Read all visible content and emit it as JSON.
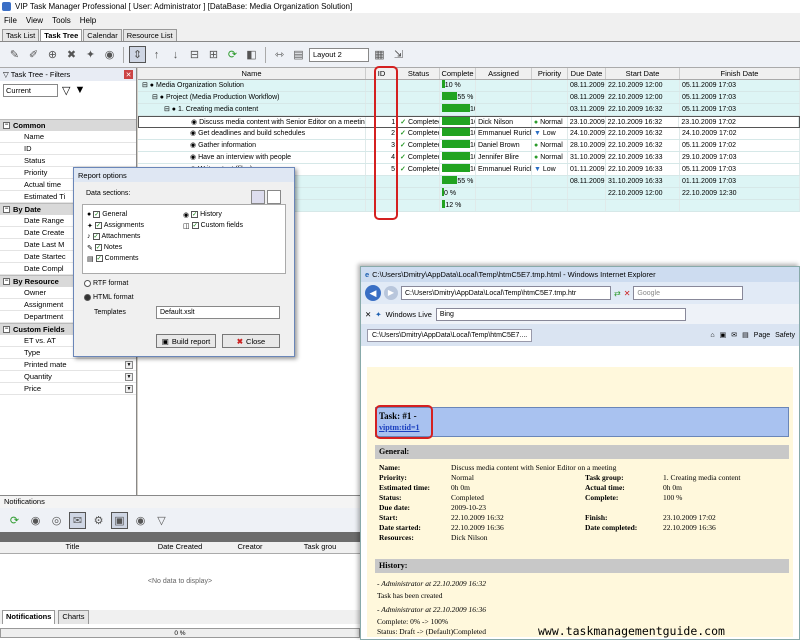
{
  "app": {
    "title": "VIP Task Manager Professional [ User: Administrator ] [DataBase: Media Organization Solution]",
    "menu": [
      "File",
      "View",
      "Tools",
      "Help"
    ],
    "tabs": [
      "Task List",
      "Task Tree",
      "Calendar",
      "Resource List"
    ],
    "active_tab": "Task Tree",
    "layout_select": "Layout 2"
  },
  "left_panel": {
    "title": "Task Tree - Filters",
    "filter_combo": "Current",
    "sections": [
      {
        "name": "Common",
        "items": [
          "Name",
          "ID",
          "Status",
          "Priority",
          "Actual time",
          "Estimated Ti"
        ]
      },
      {
        "name": "By Date",
        "items": [
          "Date Range",
          "Date Create",
          "Date Last M",
          "Date Startec",
          "Date Compl"
        ]
      },
      {
        "name": "By Resource",
        "items": [
          "Owner",
          "Assignment",
          "Department"
        ]
      },
      {
        "name": "Custom Fields",
        "items": [
          "ET vs. AT",
          "Type",
          "Printed mate",
          "Quantity",
          "Price"
        ]
      }
    ]
  },
  "grid": {
    "columns": [
      "Name",
      "ID",
      "Status",
      "Complete",
      "Assigned",
      "Priority",
      "Due Date",
      "Start Date",
      "Finish Date"
    ],
    "rows": [
      {
        "name": "Media Organization Solution",
        "id": "",
        "status": "",
        "complete": "10 %",
        "assigned": "",
        "priority": "",
        "due": "08.11.2009",
        "start": "22.10.2009 12:00",
        "finish": "05.11.2009 17:03"
      },
      {
        "name": "Project (Media Production Workflow)",
        "id": "",
        "status": "",
        "complete": "55 %",
        "assigned": "",
        "priority": "",
        "due": "08.11.2009",
        "start": "22.10.2009 12:00",
        "finish": "05.11.2009 17:03"
      },
      {
        "name": "1. Creating media content",
        "id": "",
        "status": "",
        "complete": "100 %",
        "assigned": "",
        "priority": "",
        "due": "03.11.2009",
        "start": "22.10.2009 16:32",
        "finish": "05.11.2009 17:03"
      },
      {
        "name": "Discuss media content with Senior Editor on a meeting",
        "id": "1",
        "status": "Completed",
        "complete": "100 %",
        "assigned": "Dick Nilson",
        "priority": "Normal",
        "due": "23.10.2009",
        "start": "22.10.2009 16:32",
        "finish": "23.10.2009 17:02"
      },
      {
        "name": "Get deadlines and build schedules",
        "id": "2",
        "status": "Completed",
        "complete": "100 %",
        "assigned": "Emmanuel Rurichi",
        "priority": "Low",
        "due": "24.10.2009",
        "start": "22.10.2009 16:32",
        "finish": "24.10.2009 17:02"
      },
      {
        "name": "Gather information",
        "id": "3",
        "status": "Completed",
        "complete": "100 %",
        "assigned": "Daniel Brown",
        "priority": "Normal",
        "due": "28.10.2009",
        "start": "22.10.2009 16:32",
        "finish": "05.11.2009 17:02"
      },
      {
        "name": "Have an interview with people",
        "id": "4",
        "status": "Completed",
        "complete": "100 %",
        "assigned": "Jennifer Blire",
        "priority": "Normal",
        "due": "31.10.2009",
        "start": "22.10.2009 16:33",
        "finish": "29.10.2009 17:03"
      },
      {
        "name": "Write a text (files)",
        "id": "5",
        "status": "Completed",
        "complete": "100 %",
        "assigned": "Emmanuel Rurichi",
        "priority": "Low",
        "due": "01.11.2009",
        "start": "22.10.2009 16:33",
        "finish": "05.11.2009 17:03"
      },
      {
        "name": "",
        "id": "",
        "status": "",
        "complete": "55 %",
        "assigned": "",
        "priority": "",
        "due": "08.11.2009",
        "start": "31.10.2009 16:33",
        "finish": "01.11.2009 17:03"
      },
      {
        "name": "",
        "id": "",
        "status": "",
        "complete": "0 %",
        "assigned": "",
        "priority": "",
        "due": "",
        "start": "22.10.2009 12:00",
        "finish": "22.10.2009 12:30"
      },
      {
        "name": "",
        "id": "",
        "status": "",
        "complete": "12 %",
        "assigned": "",
        "priority": "",
        "due": "",
        "start": "",
        "finish": ""
      }
    ]
  },
  "dialog": {
    "title": "Report options",
    "data_sections_label": "Data sections:",
    "left_checks": [
      "General",
      "Assignments",
      "Attachments",
      "Notes",
      "Comments"
    ],
    "right_checks": [
      "History",
      "Custom fields"
    ],
    "rtf": "RTF format",
    "html": "HTML format",
    "templates_label": "Templates",
    "template_value": "Default.xslt",
    "build": "Build report",
    "close": "Close"
  },
  "notifications": {
    "title": "Notifications",
    "columns": [
      "Title",
      "Date Created",
      "Creator",
      "Task grou"
    ],
    "empty": "<No data to display>",
    "tabs": [
      "Notifications",
      "Charts"
    ],
    "progress": "0 %"
  },
  "browser": {
    "title": "C:\\Users\\Dmitry\\AppData\\Local\\Temp\\htmC5E7.tmp.html - Windows Internet Explorer",
    "url": "C:\\Users\\Dmitry\\AppData\\Local\\Temp\\htmC5E7.tmp.htr",
    "search_placeholder": "Google",
    "windows_live": "Windows Live",
    "bing": "Bing",
    "tab_label": "C:\\Users\\Dmitry\\AppData\\Local\\Temp\\htmC5E7....",
    "page_menu": "Page",
    "safety_menu": "Safety",
    "report": {
      "task_heading": "Task: #1 -",
      "task_link": "viptm:tid=1",
      "general": "General:",
      "name_k": "Name:",
      "name_v": "Discuss media content with Senior Editor on a meeting",
      "priority_k": "Priority:",
      "priority_v": "Normal",
      "est_k": "Estimated time:",
      "est_v": "0h 0m",
      "status_k": "Status:",
      "status_v": "Completed",
      "due_k": "Due date:",
      "due_v": "2009-10-23",
      "start_k": "Start:",
      "start_v": "22.10.2009 16:32",
      "started_k": "Date started:",
      "started_v": "22.10.2009 16:36",
      "res_k": "Resources:",
      "res_v": "Dick Nilson",
      "group_k": "Task group:",
      "group_v": "1. Creating media content",
      "actual_k": "Actual time:",
      "actual_v": "0h 0m",
      "complete_k": "Complete:",
      "complete_v": "100 %",
      "finish_k": "Finish:",
      "finish_v": "23.10.2009 17:02",
      "completed_k": "Date completed:",
      "completed_v": "22.10.2009 16:36",
      "history": "History:",
      "h1": "- Administrator at 22.10.2009 16:32",
      "h1b": "Task has been created",
      "h2": "- Administrator at 22.10.2009 16:36",
      "h2b": "Complete: 0% -> 100%",
      "h2c": "Status: Draft -> (Default)Completed"
    }
  },
  "watermark": "www.taskmanagementguide.com"
}
